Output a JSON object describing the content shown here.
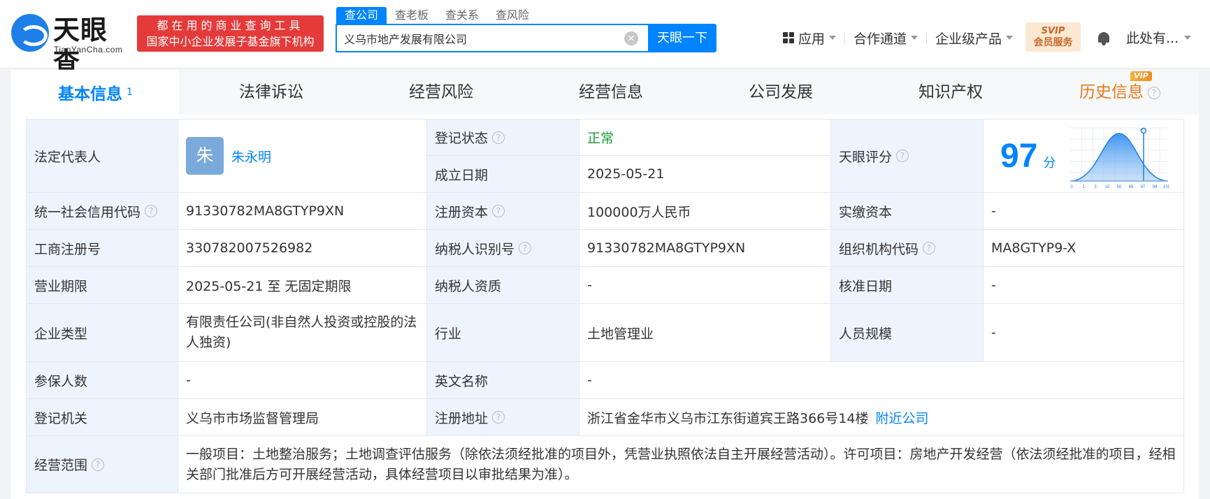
{
  "header": {
    "logo_cn": "天眼查",
    "logo_en": "TianYanCha.com",
    "slogan_line1": "都在用的商业查询工具",
    "slogan_line2": "国家中小企业发展子基金旗下机构",
    "search_tabs": [
      "查公司",
      "查老板",
      "查关系",
      "查风险"
    ],
    "search_value": "义乌市地产发展有限公司",
    "search_button": "天眼一下",
    "nav": [
      "应用",
      "合作通道",
      "企业级产品"
    ],
    "svip_line1": "SVIP",
    "svip_line2": "会员服务",
    "user": "此处有..."
  },
  "tabs": [
    {
      "label": "基本信息",
      "badge": "1"
    },
    {
      "label": "法律诉讼"
    },
    {
      "label": "经营风险"
    },
    {
      "label": "经营信息"
    },
    {
      "label": "公司发展"
    },
    {
      "label": "知识产权"
    },
    {
      "label": "历史信息",
      "tag": "VIP"
    }
  ],
  "info": {
    "legal_rep_label": "法定代表人",
    "legal_rep_avatar": "朱",
    "legal_rep_name": "朱永明",
    "reg_status_label": "登记状态",
    "reg_status": "正常",
    "found_date_label": "成立日期",
    "found_date": "2025-05-21",
    "score_label": "天眼评分",
    "score": "97",
    "score_unit": "分",
    "credit_code_label": "统一社会信用代码",
    "credit_code": "91330782MA8GTYP9XN",
    "reg_capital_label": "注册资本",
    "reg_capital": "100000万人民币",
    "paid_capital_label": "实缴资本",
    "paid_capital": "-",
    "biz_reg_no_label": "工商注册号",
    "biz_reg_no": "330782007526982",
    "taxpayer_id_label": "纳税人识别号",
    "taxpayer_id": "91330782MA8GTYP9XN",
    "org_code_label": "组织机构代码",
    "org_code": "MA8GTYP9-X",
    "biz_term_label": "营业期限",
    "biz_term": "2025-05-21 至 无固定期限",
    "taxpayer_qual_label": "纳税人资质",
    "taxpayer_qual": "-",
    "approve_date_label": "核准日期",
    "approve_date": "-",
    "ent_type_label": "企业类型",
    "ent_type": "有限责任公司(非自然人投资或控股的法人独资)",
    "industry_label": "行业",
    "industry": "土地管理业",
    "staff_size_label": "人员规模",
    "staff_size": "-",
    "insured_label": "参保人数",
    "insured": "-",
    "en_name_label": "英文名称",
    "en_name": "-",
    "reg_authority_label": "登记机关",
    "reg_authority": "义乌市市场监督管理局",
    "reg_address_label": "注册地址",
    "reg_address": "浙江省金华市义乌市江东街道宾王路366号14楼",
    "nearby_link": "附近公司",
    "scope_label": "经营范围",
    "scope": "一般项目：土地整治服务；土地调查评估服务（除依法须经批准的项目外，凭营业执照依法自主开展经营活动）。许可项目：房地产开发经营（依法须经批准的项目，经相关部门批准后方可开展经营活动，具体经营项目以审批结果为准）。"
  },
  "score_chart": {
    "x_ticks": [
      "0",
      "1",
      "3",
      "15",
      "50",
      "85",
      "97",
      "99",
      "100"
    ],
    "marker": "97"
  },
  "colors": {
    "accent": "#0084ff",
    "status_ok": "#1a9b3d",
    "history": "#e67a18",
    "label_bg": "#eef4fd"
  }
}
